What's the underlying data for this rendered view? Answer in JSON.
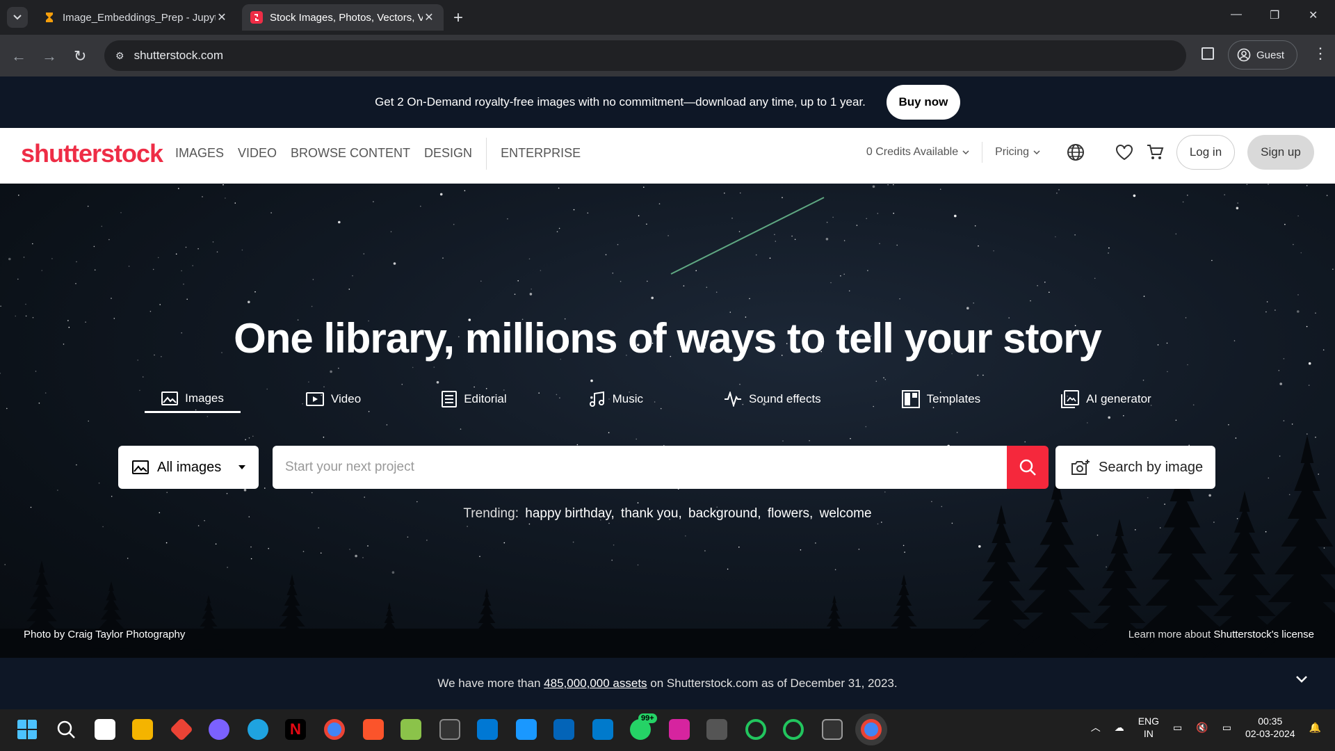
{
  "browser": {
    "tabs": [
      {
        "title": "Image_Embeddings_Prep - Jupyter",
        "active": false
      },
      {
        "title": "Stock Images, Photos, Vectors, Video",
        "active": true
      }
    ],
    "url": "shutterstock.com",
    "profile_label": "Guest"
  },
  "promo": {
    "text": "Get 2 On-Demand royalty-free images with no commitment—download any time, up to 1 year.",
    "button": "Buy now"
  },
  "header": {
    "logo": "shutterstock",
    "nav": [
      "IMAGES",
      "VIDEO",
      "BROWSE CONTENT",
      "DESIGN",
      "ENTERPRISE"
    ],
    "credits": "0 Credits Available",
    "pricing": "Pricing",
    "login": "Log in",
    "signup": "Sign up",
    "brand_color": "#ee2d46"
  },
  "hero": {
    "headline": "One library, millions of ways to tell your story",
    "types": [
      "Images",
      "Video",
      "Editorial",
      "Music",
      "Sound effects",
      "Templates",
      "AI generator"
    ],
    "active_type": "Images",
    "filter": "All images",
    "search_placeholder": "Start your next project",
    "search_by_image": "Search by image",
    "trending_label": "Trending:",
    "trending": [
      "happy birthday,",
      "thank you,",
      "background,",
      "flowers,",
      "welcome"
    ],
    "photo_credit_prefix": "Photo by",
    "photo_credit_name": "Craig Taylor Photography",
    "license_prefix": "Learn more about",
    "license_link": "Shutterstock's license"
  },
  "assets": {
    "prefix": "We have more than",
    "count": "485,000,000 assets",
    "suffix": "on Shutterstock.com as of December 31, 2023."
  },
  "taskbar": {
    "badge": "99+",
    "lang_line1": "ENG",
    "lang_line2": "IN",
    "time": "00:35",
    "date": "02-03-2024"
  }
}
